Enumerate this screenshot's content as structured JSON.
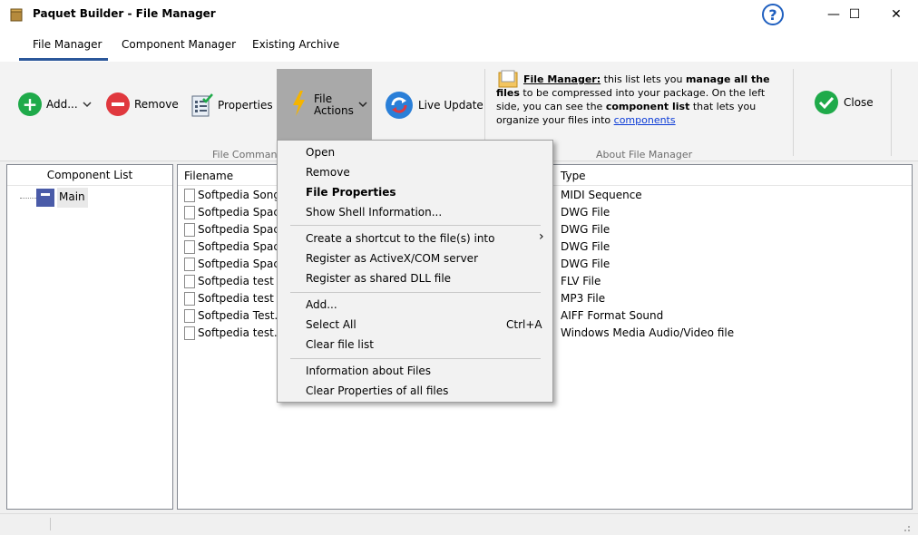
{
  "window": {
    "title": "Paquet Builder - File Manager",
    "help_label": "?",
    "minimize_label": "—",
    "maximize_label": "☐",
    "close_label": "✕"
  },
  "ribbon_tabs": [
    "File Manager",
    "Component Manager",
    "Existing Archive"
  ],
  "ribbon": {
    "add_label": "Add...",
    "remove_label": "Remove",
    "properties_label": "Properties",
    "file_actions_line1": "File",
    "file_actions_line2": "Actions",
    "live_update_label": "Live Update",
    "file_commands_group": "File Commands",
    "about_group": "About File Manager",
    "close_label": "Close",
    "about": {
      "link_title": "File Manager:",
      "t1": " this list lets you ",
      "b1": "manage all the files",
      "t2": " to be compressed into your package. On the left side, you can see the ",
      "b2": "component list",
      "t3": " that lets you organize your files into ",
      "link2": "components"
    }
  },
  "component_panel": {
    "header": "Component List",
    "root_item": "Main"
  },
  "files_panel": {
    "col_filename": "Filename",
    "col_type": "Type",
    "rows": [
      {
        "name": "Softpedia Song.mid",
        "type": "MIDI Sequence"
      },
      {
        "name": "Softpedia Space 1.dwg",
        "type": "DWG File"
      },
      {
        "name": "Softpedia Space 2.dwg",
        "type": "DWG File"
      },
      {
        "name": "Softpedia Space 3.dwg",
        "type": "DWG File"
      },
      {
        "name": "Softpedia Space 4.dwg",
        "type": "DWG File"
      },
      {
        "name": "Softpedia test slide.flv",
        "type": "FLV File"
      },
      {
        "name": "Softpedia test slide.mp3",
        "type": "MP3 File"
      },
      {
        "name": "Softpedia Test.aiff",
        "type": "AIFF Format Sound"
      },
      {
        "name": "Softpedia test.asf",
        "type": "Windows Media Audio/Video file"
      }
    ]
  },
  "context_menu": {
    "open": "Open",
    "remove": "Remove",
    "file_properties": "File Properties",
    "show_shell": "Show Shell Information...",
    "create_shortcut": "Create a shortcut to the file(s) into",
    "submenu_arrow": "›",
    "register_activex": "Register as ActiveX/COM server",
    "register_dll": "Register as shared DLL file",
    "add": "Add...",
    "select_all": "Select All",
    "select_all_shortcut": "Ctrl+A",
    "clear_list": "Clear file list",
    "info_files": "Information about Files",
    "clear_props": "Clear Properties of all files"
  },
  "colors": {
    "accent": "#2b579a",
    "add_green": "#1faa4a",
    "remove_red": "#e0383e",
    "lightning_yellow": "#f5b400",
    "live_update_blue": "#2a7fd8"
  },
  "icons": [
    "app-icon",
    "add-icon",
    "remove-icon",
    "properties-icon",
    "lightning-icon",
    "live-update-icon",
    "about-icon",
    "close-check-icon",
    "folder-icon",
    "file-icon",
    "chevron-down-icon"
  ]
}
